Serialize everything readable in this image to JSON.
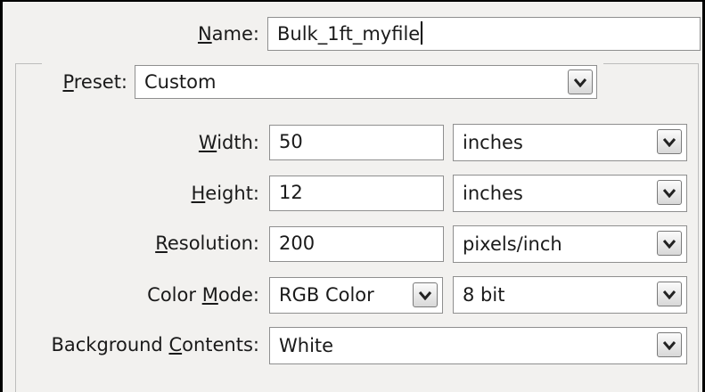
{
  "dialog": {
    "name_label_prefix": "",
    "name_label_mnemonic": "N",
    "name_label_rest": "ame:",
    "name_value": "Bulk_1ft_myfile",
    "preset": {
      "label_mnemonic": "P",
      "label_rest": "reset:",
      "value": "Custom",
      "arrow_icon": "chevron-down-icon"
    },
    "width": {
      "label_mnemonic": "W",
      "label_rest": "idth:",
      "value": "50",
      "unit": "inches"
    },
    "height": {
      "label_mnemonic": "H",
      "label_rest": "eight:",
      "value": "12",
      "unit": "inches"
    },
    "resolution": {
      "label_mnemonic": "R",
      "label_rest": "esolution:",
      "value": "200",
      "unit": "pixels/inch"
    },
    "color_mode": {
      "label_prefix": "Color ",
      "label_mnemonic": "M",
      "label_rest": "ode:",
      "value": "RGB Color",
      "depth": "8 bit"
    },
    "background": {
      "label_prefix": "Background ",
      "label_mnemonic": "C",
      "label_rest": "ontents:",
      "value": "White"
    }
  }
}
